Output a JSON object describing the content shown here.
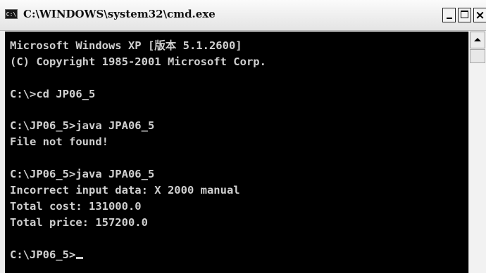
{
  "window": {
    "title": "C:\\WINDOWS\\system32\\cmd.exe",
    "icon_label": "C:\\",
    "icon": "console-window-icon",
    "controls": {
      "minimize": "minimize-icon",
      "maximize": "maximize-icon",
      "close_label": "×"
    }
  },
  "console": {
    "lines": [
      "Microsoft Windows XP [版本 5.1.2600]",
      "(C) Copyright 1985-2001 Microsoft Corp.",
      "",
      "C:\\>cd JP06_5",
      "",
      "C:\\JP06_5>java JPA06_5",
      "File not found!",
      "",
      "C:\\JP06_5>java JPA06_5",
      "Incorrect input data: X 2000 manual",
      "Total cost: 131000.0",
      "Total price: 157200.0",
      "",
      "C:\\JP06_5>"
    ],
    "text_color": "#cfcfcf",
    "background": "#000000"
  },
  "scrollbar": {
    "up_arrow": "scroll-up-arrow-icon"
  }
}
